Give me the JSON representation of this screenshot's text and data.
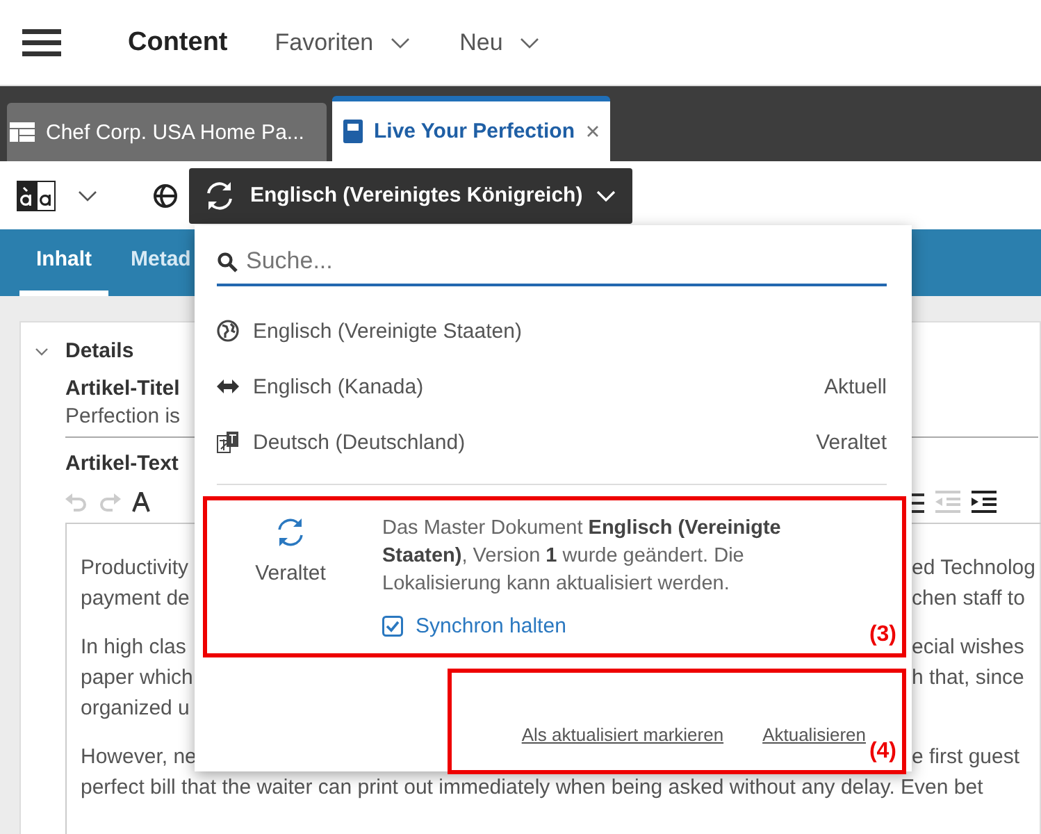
{
  "header": {
    "items": [
      {
        "label": "Content",
        "kind": "title"
      },
      {
        "label": "Favoriten",
        "kind": "dropdown"
      },
      {
        "label": "Neu",
        "kind": "dropdown"
      }
    ]
  },
  "tabs": [
    {
      "label": "Chef Corp. USA Home Pa...",
      "kind": "page",
      "selected": false
    },
    {
      "label": "Live Your Perfection",
      "kind": "article",
      "selected": true
    }
  ],
  "toolbar": {
    "locale_button": "Englisch (Vereinigtes Königreich)"
  },
  "nav_tabs": [
    {
      "label": "Inhalt",
      "selected": true
    },
    {
      "label": "Metad",
      "selected": false
    }
  ],
  "details": {
    "title": "Details",
    "expanded": true,
    "title_label": "Artikel-Titel",
    "title_value": "Perfection is",
    "text_label": "Artikel-Text",
    "paragraphs": [
      [
        {
          "left": "Productivity",
          "right": "ed Technolog"
        },
        {
          "left": "payment de",
          "right": "chen staff to"
        }
      ],
      [
        {
          "left": "In high clas",
          "right": "ecial wishes"
        },
        {
          "left": "paper which",
          "right": "h that, since"
        },
        {
          "left": "organized u"
        }
      ],
      [
        {
          "left": "However, ne",
          "right": "e first guest"
        },
        {
          "left": "perfect bill that the waiter can print out immediately when being asked without any delay. Even bet"
        }
      ]
    ]
  },
  "dropdown": {
    "search": {
      "placeholder": "Suche..."
    },
    "languages": [
      {
        "name": "Englisch (Vereinigte Staaten)",
        "kind": "master"
      },
      {
        "name": "Englisch (Kanada)",
        "kind": "sync",
        "status": "Aktuell"
      },
      {
        "name": "Deutsch (Deutschland)",
        "kind": "translate",
        "status": "Veraltet"
      }
    ],
    "notice": {
      "status": "Veraltet",
      "message": "Das Master Dokument **Englisch (Vereinigte Staaten)**, Version **1** wurde geändert. Die Lokalisierung kann aktualisiert werden.",
      "sync": {
        "label": "Synchron halten",
        "checked": true
      },
      "annotation": "(3)"
    },
    "actions": [
      "Als aktualisiert markieren",
      "Aktualisieren"
    ],
    "actions_annotation": "(4)"
  }
}
